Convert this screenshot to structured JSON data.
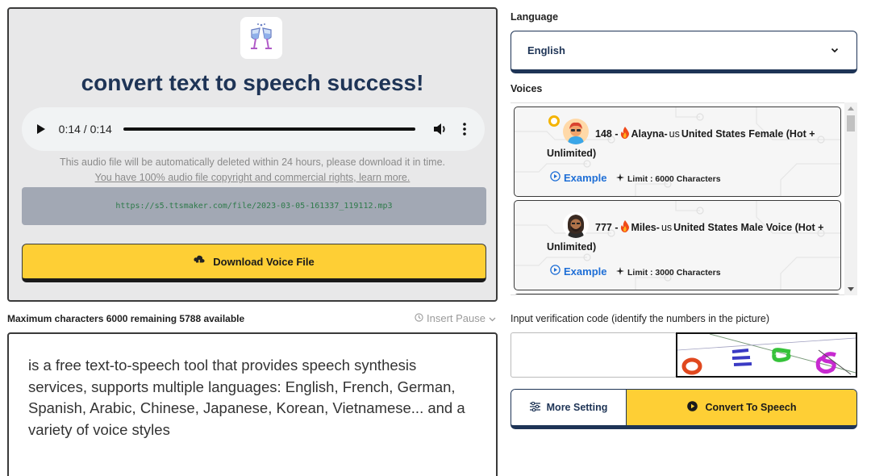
{
  "result": {
    "title": "convert text to speech success!",
    "player": {
      "time": "0:14 / 0:14",
      "progress": 1.0
    },
    "delete_notice": "This audio file will be automatically deleted within 24 hours, please download it in time.",
    "rights_link": "You have 100% audio file copyright and commercial rights, learn more.",
    "file_url": "https://s5.ttsmaker.com/file/2023-03-05-161337_119112.mp3",
    "download_label": "Download Voice File"
  },
  "editor": {
    "char_info": "Maximum characters 6000 remaining 5788 available",
    "insert_pause": "Insert Pause",
    "text": "is a free text-to-speech tool that provides speech synthesis services, supports multiple languages: English, French, German, Spanish, Arabic, Chinese, Japanese, Korean, Vietnamese... and a variety of voice styles"
  },
  "language": {
    "label": "Language",
    "selected": "English"
  },
  "voices": {
    "label": "Voices",
    "items": [
      {
        "id": "148",
        "prefix": "148 - ",
        "name": "Alayna-",
        "code": "us",
        "desc_line1": "United States Female (Hot +",
        "desc_line2": "Unlimited)",
        "example": "Example",
        "limit": "Limit : 6000 Characters",
        "selected": true
      },
      {
        "id": "777",
        "prefix": "777 - ",
        "name": "Miles-",
        "code": "us",
        "desc_line1": "United States Male Voice (Hot +",
        "desc_line2": "Unlimited)",
        "example": "Example",
        "limit": "Limit : 3000 Characters",
        "selected": false
      }
    ]
  },
  "verification": {
    "label": "Input verification code (identify the numbers in the picture)",
    "value": "",
    "captcha_text": "0 2 6 6"
  },
  "actions": {
    "more_setting": "More Setting",
    "convert": "Convert To Speech"
  },
  "colors": {
    "accent_yellow": "#fecf35",
    "navy": "#1e3456",
    "link_blue": "#1f6fd6",
    "url_green": "#2e7a4a"
  }
}
